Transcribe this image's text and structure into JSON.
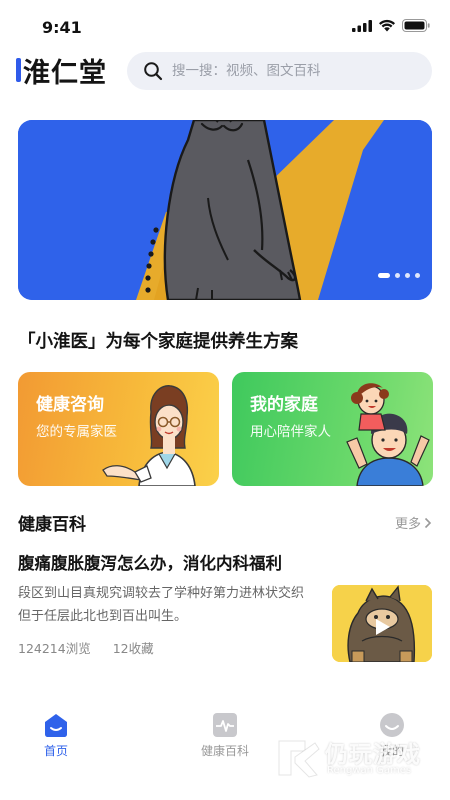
{
  "status_bar": {
    "time": "9:41",
    "icons": [
      "signal-icon",
      "wifi-icon",
      "battery-icon"
    ]
  },
  "header": {
    "logo_text": "淮仁堂",
    "search": {
      "placeholder": "搜一搜：视频、图文百科",
      "icon": "search-icon"
    }
  },
  "banner": {
    "slide_count": 4,
    "active_slide": 1
  },
  "tagline": "「小淮医」为每个家庭提供养生方案",
  "cards": [
    {
      "title": "健康咨询",
      "subtitle": "您的专属家医"
    },
    {
      "title": "我的家庭",
      "subtitle": "用心陪伴家人"
    }
  ],
  "health_section": {
    "title": "健康百科",
    "more_label": "更多"
  },
  "article": {
    "title": "腹痛腹胀腹泻怎么办，消化内科福利",
    "description": "段区到山目真规究调较去了学种好第力进林状交织但于任层此北也到百出叫生。",
    "views": "124214浏览",
    "favorites": "12收藏"
  },
  "tabbar": {
    "items": [
      {
        "label": "首页",
        "icon": "home-icon",
        "active": true
      },
      {
        "label": "健康百科",
        "icon": "pulse-icon",
        "active": false
      },
      {
        "label": "我的",
        "icon": "profile-icon",
        "active": false
      }
    ]
  },
  "watermark": {
    "text": "仍玩游戏",
    "subtext": "Rengwan Games"
  },
  "colors": {
    "accent": "#2f62ea",
    "banner_yellow": "#e7ab2b",
    "card_orange": "#f5a93a",
    "card_green": "#5bd065"
  }
}
